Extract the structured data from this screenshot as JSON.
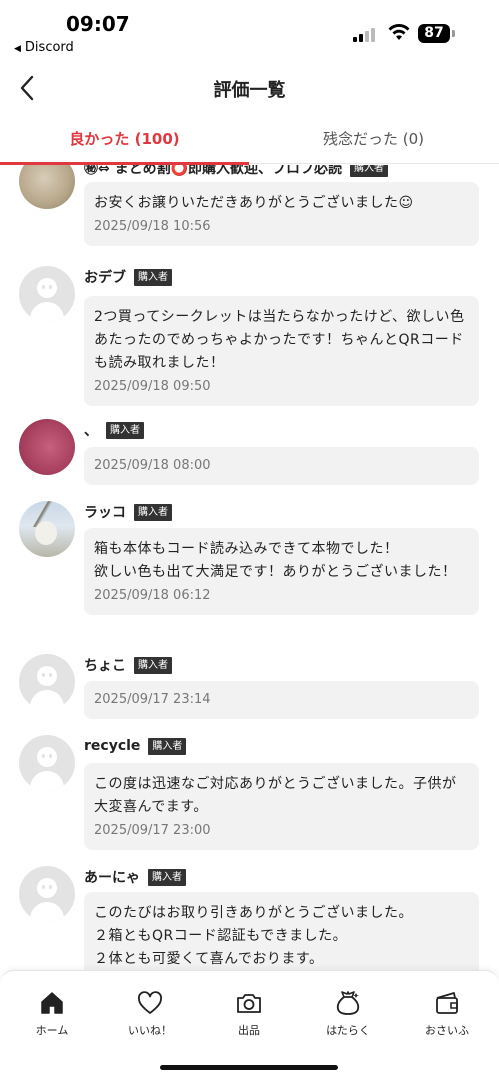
{
  "status_bar": {
    "time": "09:07",
    "back_app": "Discord",
    "battery": "87"
  },
  "header": {
    "title": "評価一覧"
  },
  "tabs": [
    {
      "label": "良かった (100)",
      "active": true
    },
    {
      "label": "残念だった (0)",
      "active": false
    }
  ],
  "badge_label": "購入者",
  "reviews": [
    {
      "name": "㊙⇔ まとめ割⭕即購入歓迎、プロフ必読",
      "text": "お安くお譲りいただきありがとうございました☺",
      "date": "2025/09/18 10:56",
      "avatar": "sketch"
    },
    {
      "name": "おデブ",
      "text": "2つ買ってシークレットは当たらなかったけど、欲しい色あたったのでめっちゃよかったです！ちゃんとQRコードも読み取れました！",
      "date": "2025/09/18 09:50",
      "avatar": "default"
    },
    {
      "name": "、",
      "text": "",
      "date": "2025/09/18 08:00",
      "avatar": "pink"
    },
    {
      "name": "ラッコ",
      "text": "箱も本体もコード読み込みできて本物でした！\n欲しい色も出て大満足です！ありがとうございました！",
      "date": "2025/09/18 06:12",
      "avatar": "photo"
    },
    {
      "name": "ちょこ",
      "text": "",
      "date": "2025/09/17 23:14",
      "avatar": "default"
    },
    {
      "name": "recycle",
      "text": "この度は迅速なご対応ありがとうございました。子供が大変喜んでます。",
      "date": "2025/09/17 23:00",
      "avatar": "default"
    },
    {
      "name": "あーにゃ",
      "text": "このたびはお取り引きありがとうございました。\n２箱ともQRコード認証もできました。\n２体とも可愛くて喜んでおります。",
      "date": "",
      "avatar": "default"
    }
  ],
  "bottom_nav": [
    {
      "label": "ホーム",
      "icon": "home-icon"
    },
    {
      "label": "いいね！",
      "icon": "heart-icon"
    },
    {
      "label": "出品",
      "icon": "camera-icon"
    },
    {
      "label": "はたらく",
      "icon": "money-bag-icon"
    },
    {
      "label": "おさいふ",
      "icon": "wallet-icon"
    }
  ],
  "colors": {
    "accent": "#e0383e",
    "bubble": "#f2f2f2",
    "badge": "#333333"
  }
}
